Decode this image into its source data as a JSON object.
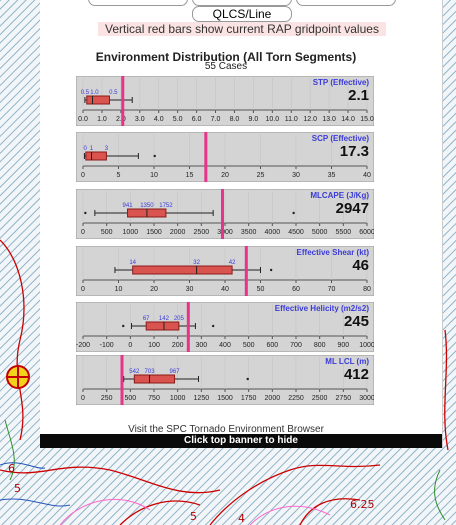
{
  "top_tabs": {
    "qlcs_label": "QLCS/Line"
  },
  "note": "Vertical red bars show current RAP gridpoint values",
  "section": {
    "title": "Environment Distribution (All Torn Segments)",
    "cases": "55 Cases"
  },
  "footer": {
    "visit_text": "Visit the SPC Tornado Environment Browser",
    "banner": "Click top banner to hide"
  },
  "map_labels": [
    "6",
    "5",
    "5",
    "4",
    "6.25"
  ],
  "colors": {
    "current_bar": "#e8338a",
    "box_fill": "#d9534f",
    "box_stroke": "#8b1a1a",
    "panel_bg": "#d4d4d4",
    "label_color": "#3b3bd9"
  },
  "plots": [
    {
      "key": "stp",
      "label": "STP (Effective)",
      "value": "2.1",
      "current": 2.1,
      "min": 0,
      "max": 15,
      "ticks": [
        "0.0",
        "1.0",
        "2.0",
        "3.0",
        "4.0",
        "5.0",
        "6.0",
        "7.0",
        "8.0",
        "9.0",
        "10.0",
        "11.0",
        "12.0",
        "13.0",
        "14.0",
        "15.0"
      ],
      "box": {
        "w_low": 0.1,
        "q1": 0.2,
        "median": 0.5,
        "q3": 1.4,
        "w_high": 2.6
      },
      "box_labels": [
        {
          "v": 0.1,
          "t": "0.5"
        },
        {
          "v": 0.6,
          "t": "1.0"
        },
        {
          "v": 1.6,
          "t": "0.5"
        }
      ],
      "outliers": []
    },
    {
      "key": "scp",
      "label": "SCP (Effective)",
      "value": "17.3",
      "current": 17.3,
      "min": 0,
      "max": 40,
      "ticks": [
        "0",
        "5",
        "10",
        "15",
        "20",
        "25",
        "30",
        "35",
        "40"
      ],
      "box": {
        "w_low": 0.2,
        "q1": 0.4,
        "median": 1.2,
        "q3": 3.3,
        "w_high": 7.8
      },
      "box_labels": [
        {
          "v": 0.3,
          "t": "0"
        },
        {
          "v": 1.2,
          "t": "1"
        },
        {
          "v": 3.3,
          "t": "3"
        }
      ],
      "outliers": [
        10.1
      ]
    },
    {
      "key": "mlcape",
      "label": "MLCAPE (J/Kg)",
      "value": "2947",
      "current": 2947,
      "min": 0,
      "max": 6000,
      "ticks": [
        "0",
        "500",
        "1000",
        "1500",
        "2000",
        "2500",
        "3000",
        "3500",
        "4000",
        "4500",
        "5000",
        "5500",
        "6000"
      ],
      "box": {
        "w_low": 250,
        "q1": 941,
        "median": 1350,
        "q3": 1752,
        "w_high": 2750
      },
      "box_labels": [
        {
          "v": 941,
          "t": "941"
        },
        {
          "v": 1350,
          "t": "1350"
        },
        {
          "v": 1752,
          "t": "1752"
        }
      ],
      "outliers": [
        50,
        4450
      ]
    },
    {
      "key": "eshear",
      "label": "Effective Shear (kt)",
      "value": "46",
      "current": 46,
      "min": 0,
      "max": 80,
      "ticks": [
        "0",
        "10",
        "20",
        "30",
        "40",
        "50",
        "60",
        "70",
        "80"
      ],
      "box": {
        "w_low": 9,
        "q1": 14,
        "median": 32,
        "q3": 42,
        "w_high": 50
      },
      "box_labels": [
        {
          "v": 14,
          "t": "14"
        },
        {
          "v": 32,
          "t": "32"
        },
        {
          "v": 42,
          "t": "42"
        }
      ],
      "outliers": [
        53
      ]
    },
    {
      "key": "ehel",
      "label": "Effective Helicity (m2/s2)",
      "value": "245",
      "current": 245,
      "min": -200,
      "max": 1000,
      "ticks": [
        "-200",
        "-100",
        "0",
        "100",
        "200",
        "300",
        "400",
        "500",
        "600",
        "700",
        "800",
        "900",
        "1000"
      ],
      "box": {
        "w_low": 5,
        "q1": 67,
        "median": 142,
        "q3": 205,
        "w_high": 275
      },
      "box_labels": [
        {
          "v": 67,
          "t": "67"
        },
        {
          "v": 142,
          "t": "142"
        },
        {
          "v": 205,
          "t": "205"
        }
      ],
      "outliers": [
        -30,
        350
      ]
    },
    {
      "key": "mllcl",
      "label": "ML LCL (m)",
      "value": "412",
      "current": 412,
      "min": 0,
      "max": 3000,
      "ticks": [
        "0",
        "250",
        "500",
        "750",
        "1000",
        "1250",
        "1500",
        "1750",
        "2000",
        "2250",
        "2500",
        "2750",
        "3000"
      ],
      "box": {
        "w_low": 430,
        "q1": 542,
        "median": 703,
        "q3": 967,
        "w_high": 1220
      },
      "box_labels": [
        {
          "v": 542,
          "t": "542"
        },
        {
          "v": 703,
          "t": "703"
        },
        {
          "v": 967,
          "t": "967"
        }
      ],
      "outliers": [
        410,
        1740
      ]
    }
  ]
}
